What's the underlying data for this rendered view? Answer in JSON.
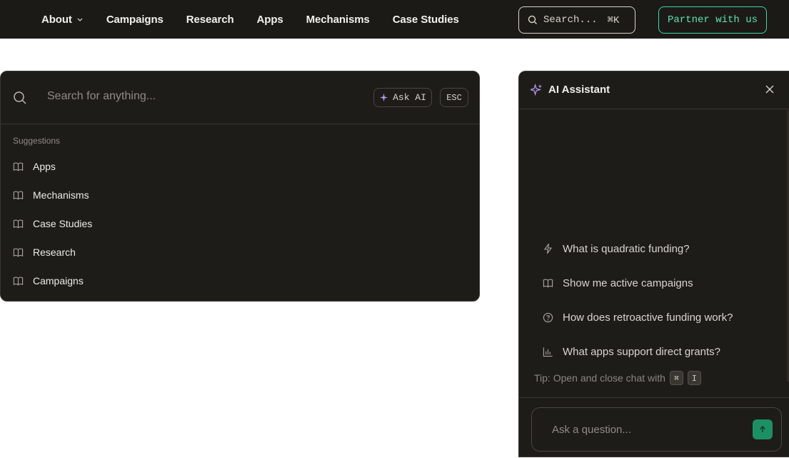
{
  "nav": {
    "links": [
      {
        "label": "About"
      },
      {
        "label": "Campaigns"
      },
      {
        "label": "Research"
      },
      {
        "label": "Apps"
      },
      {
        "label": "Mechanisms"
      },
      {
        "label": "Case Studies"
      }
    ],
    "search_label": "Search...",
    "search_shortcut": "⌘K",
    "partner_label": "Partner with us"
  },
  "palette": {
    "placeholder": "Search for anything...",
    "ask_ai_label": "Ask AI",
    "esc_label": "ESC",
    "suggestions_heading": "Suggestions",
    "suggestions": [
      {
        "label": "Apps",
        "icon": "book-icon"
      },
      {
        "label": "Mechanisms",
        "icon": "book-icon"
      },
      {
        "label": "Case Studies",
        "icon": "book-icon"
      },
      {
        "label": "Research",
        "icon": "book-icon"
      },
      {
        "label": "Campaigns",
        "icon": "book-icon"
      }
    ]
  },
  "assistant": {
    "title": "AI Assistant",
    "prompts": [
      {
        "label": "What is quadratic funding?",
        "icon": "bolt-icon"
      },
      {
        "label": "Show me active campaigns",
        "icon": "book-icon"
      },
      {
        "label": "How does retroactive funding work?",
        "icon": "help-circle-icon"
      },
      {
        "label": "What apps support direct grants?",
        "icon": "bar-chart-icon"
      }
    ],
    "tip_text": "Tip: Open and close chat with",
    "tip_keys": [
      "⌘",
      "I"
    ],
    "input_placeholder": "Ask a question...",
    "colors": {
      "accent": "#1d8f64",
      "partner_border": "#3fd6a4",
      "sparkle": "#b69cf0"
    }
  }
}
